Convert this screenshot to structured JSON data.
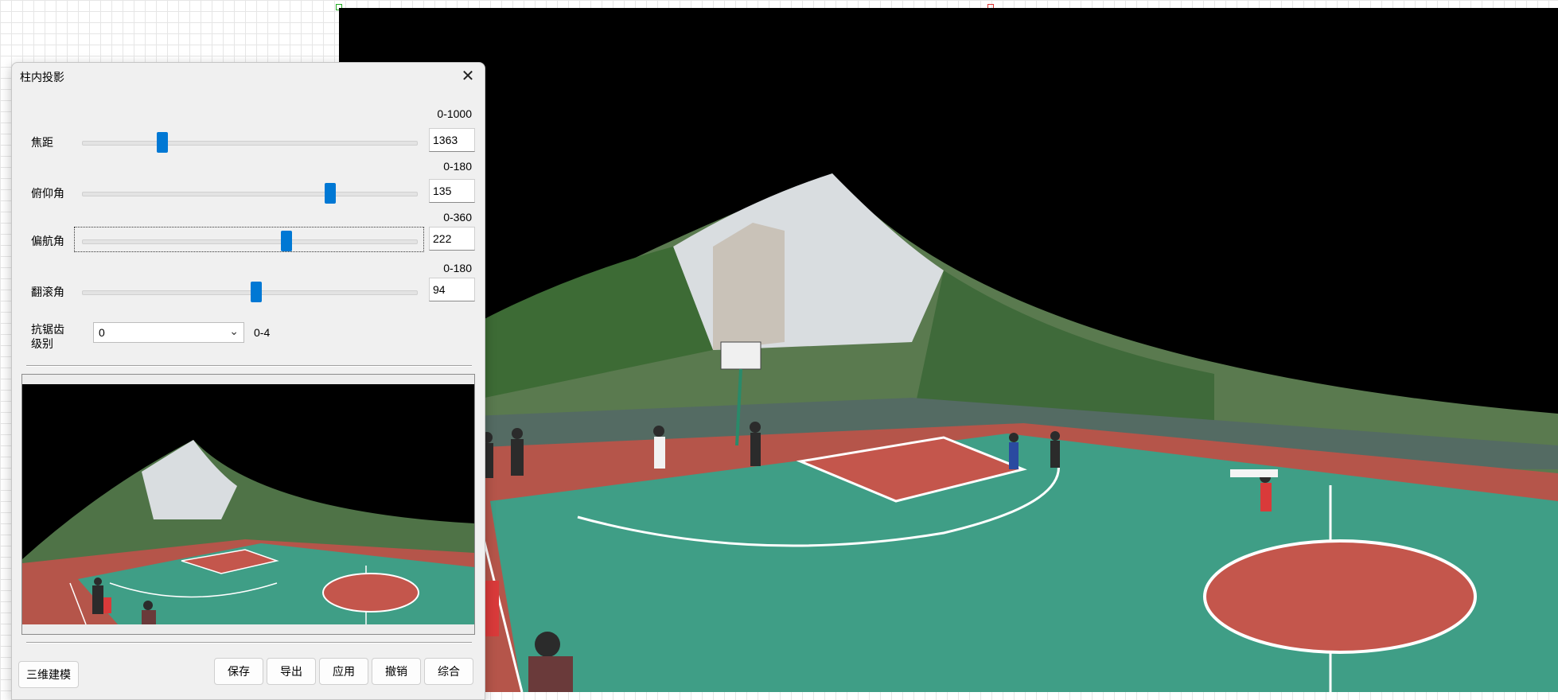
{
  "dialog": {
    "title": "柱内投影",
    "sliders": [
      {
        "label": "焦距",
        "range": "0-1000",
        "value": "1363",
        "fraction": 0.237
      },
      {
        "label": "俯仰角",
        "range": "0-180",
        "value": "135",
        "fraction": 0.74
      },
      {
        "label": "偏航角",
        "range": "0-360",
        "value": "222",
        "fraction": 0.61
      },
      {
        "label": "翻滚角",
        "range": "0-180",
        "value": "94",
        "fraction": 0.52
      }
    ],
    "antialias": {
      "label_line1": "抗锯齿",
      "label_line2": "级别",
      "value": "0",
      "range": "0-4"
    },
    "buttons": {
      "model3d": "三维建模",
      "save": "保存",
      "export": "导出",
      "apply": "应用",
      "undo": "撤销",
      "combine": "综合"
    }
  },
  "icons": {
    "close": "close-icon",
    "dropdown": "chevron-down-icon"
  },
  "colors": {
    "slider_thumb": "#0078d4",
    "court_green": "#3f9e86",
    "court_red": "#c4564c",
    "sky": "#e8eef2"
  }
}
